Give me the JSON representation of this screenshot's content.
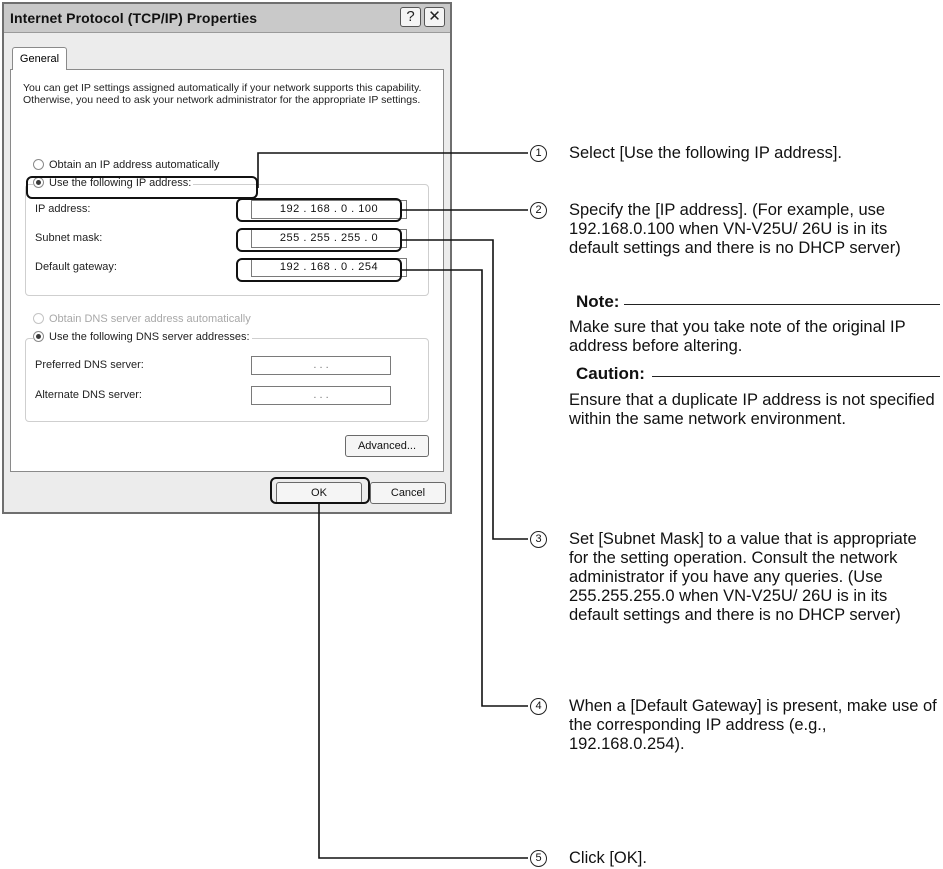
{
  "dialog": {
    "title": "Internet Protocol (TCP/IP) Properties",
    "help_glyph": "?",
    "close_glyph": "✕",
    "tab_general": "General",
    "intro": "You can get IP settings assigned automatically if your network supports this capability. Otherwise, you need to ask your network administrator for the appropriate IP settings.",
    "radio_auto_ip": "Obtain an IP address automatically",
    "radio_manual_ip": "Use the following IP address:",
    "label_ip": "IP address:",
    "label_subnet": "Subnet mask:",
    "label_gateway": "Default gateway:",
    "value_ip": "192 . 168 .  0  . 100",
    "value_subnet": "255 . 255 . 255 .  0",
    "value_gateway": "192 . 168 .  0  . 254",
    "radio_auto_dns": "Obtain DNS server address automatically",
    "radio_manual_dns": "Use the following DNS server addresses:",
    "label_pref_dns": "Preferred DNS server:",
    "label_alt_dns": "Alternate DNS server:",
    "value_pref_dns": ".        .        .",
    "value_alt_dns": ".        .        .",
    "advanced": "Advanced...",
    "ok": "OK",
    "cancel": "Cancel"
  },
  "annotations": {
    "n1": "1",
    "n2": "2",
    "n3": "3",
    "n4": "4",
    "n5": "5",
    "a1": "Select [Use the following IP address].",
    "a2": "Specify the [IP address]. (For example, use 192.168.0.100 when  VN-V25U/ 26U is in its default settings and there is no DHCP server)",
    "note_head": "Note:",
    "note_text": "Make sure that you take note of the original IP address before altering.",
    "caution_head": "Caution:",
    "caution_text": "Ensure that a duplicate IP address is not specified within the same network environment.",
    "a3": "Set [Subnet Mask] to a value that is appropriate for the setting operation. Consult the network administrator if you have any queries. (Use 255.255.255.0 when VN-V25U/ 26U is in its default settings and there is no DHCP server)",
    "a4": "When a [Default Gateway] is present, make use of the corresponding IP address (e.g., 192.168.0.254).",
    "a5": "Click [OK]."
  }
}
